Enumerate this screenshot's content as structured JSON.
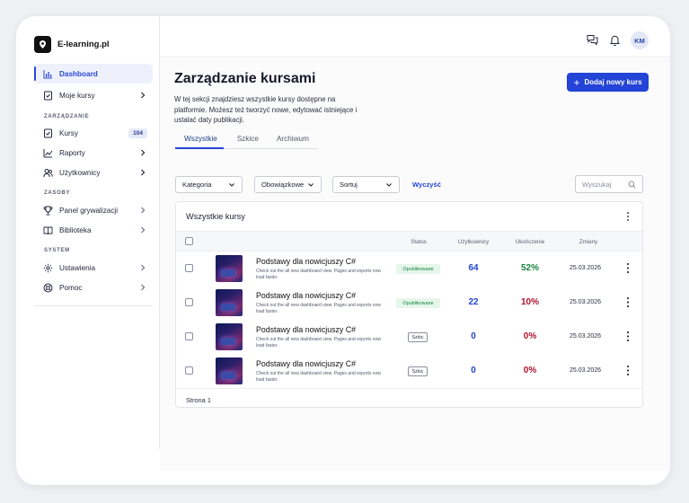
{
  "app": {
    "name": "E-learning.pl"
  },
  "sidebar": {
    "items_top": [
      {
        "label": "Dashboard",
        "icon": "bar-chart-icon",
        "active": true
      },
      {
        "label": "Moje kursy",
        "icon": "book-check-icon"
      }
    ],
    "section_manage": "ZARZĄDZANIE",
    "items_manage": [
      {
        "label": "Kursy",
        "icon": "book-icon",
        "badge": "104"
      },
      {
        "label": "Raporty",
        "icon": "line-chart-icon"
      },
      {
        "label": "Użytkownicy",
        "icon": "users-icon"
      }
    ],
    "section_resources": "ZASOBY",
    "items_resources": [
      {
        "label": "Panel grywalizacji",
        "icon": "trophy-icon"
      },
      {
        "label": "Biblioteka",
        "icon": "library-icon"
      }
    ],
    "section_system": "SYSTEM",
    "items_system": [
      {
        "label": "Ustawienia",
        "icon": "gear-icon"
      },
      {
        "label": "Pomoc",
        "icon": "help-icon"
      }
    ]
  },
  "topbar": {
    "avatar_initials": "KM"
  },
  "main": {
    "title": "Zarządzanie kursami",
    "description": "W tej sekcji znajdziesz wszystkie kursy dostępne na platformie. Możesz też tworzyć nowe, edytować istniejące i ustalać daty publikacji.",
    "add_button": "Dodaj nowy kurs",
    "tabs": [
      "Wszystkie",
      "Szkice",
      "Archiwum"
    ],
    "filters": [
      "Kategoria",
      "Obowiązkowe",
      "Sortuj"
    ],
    "clear_label": "Wyczyść",
    "search_placeholder": "Wyszukaj",
    "table": {
      "title": "Wszystkie kursy",
      "columns": [
        "Status",
        "Użytkownicy",
        "Ukończenie",
        "Zmiany"
      ],
      "rows": [
        {
          "title": "Podstawy dla nowicjuszy C#",
          "subtitle": "Check out the all new dashboard view. Pages and exports now load faster.",
          "status": "Opublikowane",
          "users": "64",
          "completion": "52%",
          "date": "25.03.2026"
        },
        {
          "title": "Podstawy dla nowicjuszy C#",
          "subtitle": "Check out the all new dashboard view. Pages and exports now load faster.",
          "status": "Opublikowane",
          "users": "22",
          "completion": "10%",
          "date": "25.03.2026"
        },
        {
          "title": "Podstawy dla nowicjuszy C#",
          "subtitle": "Check out the all new dashboard view. Pages and exports now load faster.",
          "status": "Szkic",
          "users": "0",
          "completion": "0%",
          "date": "25.03.2026"
        },
        {
          "title": "Podstawy dla nowicjuszy C#",
          "subtitle": "Check out the all new dashboard view. Pages and exports now load faster.",
          "status": "Szkic",
          "users": "0",
          "completion": "0%",
          "date": "25.03.2026"
        }
      ],
      "footer": "Strona 1"
    }
  },
  "colors": {
    "accent": "#2344d6",
    "success": "#16843c",
    "danger": "#b0122f"
  }
}
